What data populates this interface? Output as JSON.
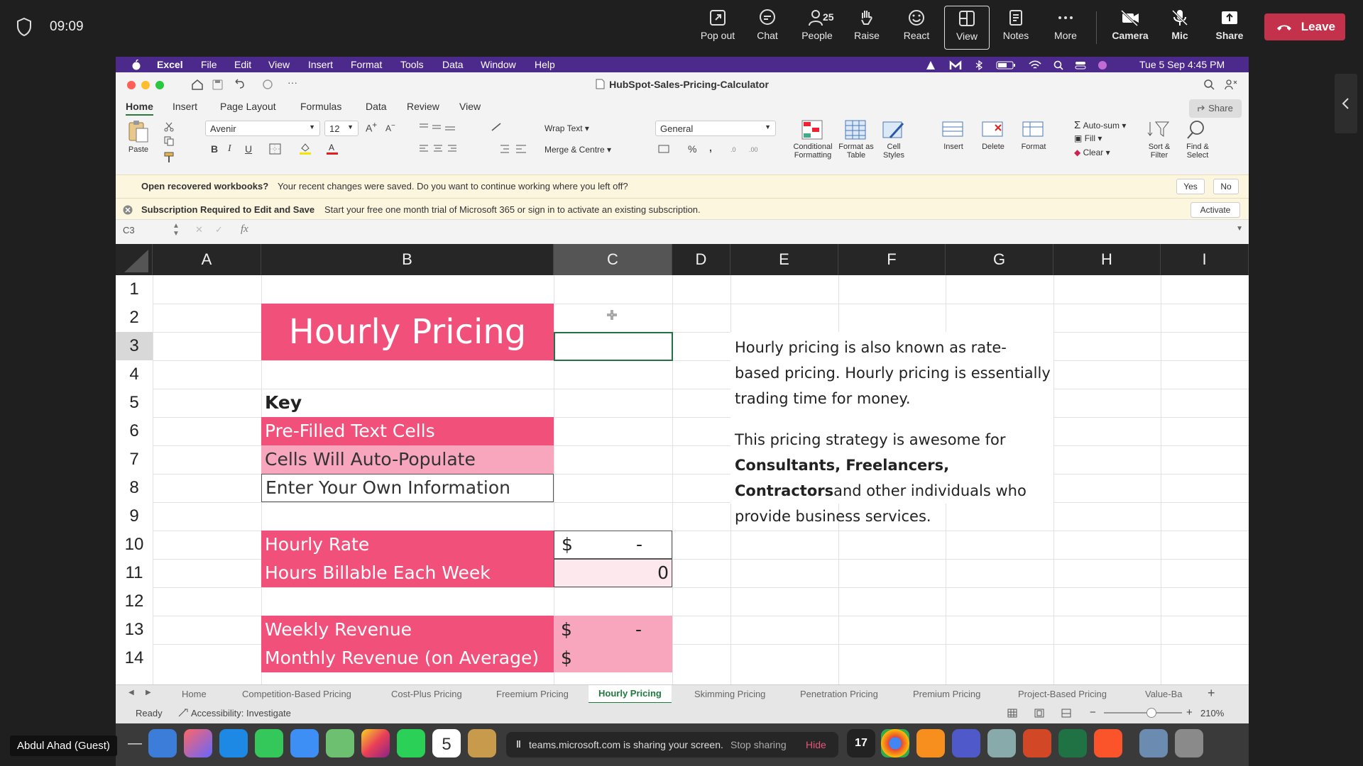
{
  "teams": {
    "time": "09:09",
    "buttons": [
      {
        "label": "Pop out",
        "icon": "pop-out-icon"
      },
      {
        "label": "Chat",
        "icon": "chat-icon"
      },
      {
        "label": "People",
        "icon": "people-icon",
        "count": "25"
      },
      {
        "label": "Raise",
        "icon": "raise-hand-icon"
      },
      {
        "label": "React",
        "icon": "react-icon"
      },
      {
        "label": "View",
        "icon": "view-icon"
      },
      {
        "label": "Notes",
        "icon": "notes-icon"
      },
      {
        "label": "More",
        "icon": "more-icon"
      },
      {
        "label": "Camera",
        "icon": "camera-off-icon"
      },
      {
        "label": "Mic",
        "icon": "mic-off-icon"
      },
      {
        "label": "Share",
        "icon": "share-icon"
      }
    ],
    "leave_label": "Leave",
    "leave_color": "#c4314b",
    "guest_name": "Abdul Ahad (Guest)"
  },
  "mac_menu": {
    "items": [
      "Excel",
      "File",
      "Edit",
      "View",
      "Insert",
      "Format",
      "Tools",
      "Data",
      "Window",
      "Help"
    ],
    "datetime": "Tue 5 Sep  4:45 PM"
  },
  "excel": {
    "title": "HubSpot-Sales-Pricing-Calculator",
    "tabs": [
      "Home",
      "Insert",
      "Page Layout",
      "Formulas",
      "Data",
      "Review",
      "View"
    ],
    "share_label": "Share",
    "ribbon": {
      "paste": "Paste",
      "font_name": "Avenir",
      "font_size": "12",
      "wrap_text": "Wrap Text",
      "merge_centre": "Merge & Centre",
      "number_format": "General",
      "conditional_formatting": "Conditional Formatting",
      "format_as_table": "Format as Table",
      "cell_styles": "Cell Styles",
      "insert": "Insert",
      "delete": "Delete",
      "format": "Format",
      "autosum": "Auto-sum",
      "fill": "Fill",
      "clear": "Clear",
      "sort_filter": "Sort & Filter",
      "find_select": "Find & Select",
      "bold": "B",
      "italic": "I",
      "underline": "U",
      "percent": "%"
    },
    "notice1": {
      "title": "Open recovered workbooks?",
      "text": "Your recent changes were saved. Do you want to continue working where you left off?",
      "yes": "Yes",
      "no": "No"
    },
    "notice2": {
      "title": "Subscription Required to Edit and Save",
      "text": "Start your free one month trial of Microsoft 365 or sign in to activate an existing subscription.",
      "button": "Activate"
    },
    "name_box": "C3",
    "fx": "fx",
    "columns": [
      "A",
      "B",
      "C",
      "D",
      "E",
      "F",
      "G",
      "H",
      "I"
    ],
    "rows": [
      "1",
      "2",
      "3",
      "4",
      "5",
      "6",
      "7",
      "8",
      "9",
      "10",
      "11",
      "12",
      "13",
      "14"
    ],
    "cells": {
      "title": "Hourly Pricing",
      "key": "Key",
      "prefilled": "Pre-Filled Text Cells",
      "autopopulate": "Cells Will Auto-Populate",
      "enter_own": "Enter Your Own Information",
      "hourly_rate": "Hourly Rate",
      "hourly_rate_currency": "$",
      "hourly_rate_value": "-",
      "hours_billable": "Hours Billable Each Week",
      "hours_billable_value": "0",
      "weekly_revenue": "Weekly Revenue",
      "weekly_revenue_currency": "$",
      "weekly_revenue_value": "-",
      "monthly_revenue": "Monthly Revenue (on Average)",
      "monthly_revenue_currency": "$"
    },
    "description": {
      "p1": "Hourly pricing is also known as rate-based pricing. Hourly pricing is essentially trading time for money.",
      "p2_start": "This pricing strategy is awesome for ",
      "p2_bold": "Consultants, Freelancers, Contractors",
      "p2_end": "and other individuals who provide business services."
    },
    "colors": {
      "pink_dark": "#f0507a",
      "pink_light": "#f7a6bd",
      "header_bg": "#262626"
    },
    "sheets": [
      "Home",
      "Competition-Based Pricing",
      "Cost-Plus Pricing",
      "Freemium Pricing",
      "Hourly Pricing",
      "Skimming Pricing",
      "Penetration Pricing",
      "Premium Pricing",
      "Project-Based Pricing",
      "Value-Ba"
    ],
    "active_sheet": "Hourly Pricing",
    "status": "Ready",
    "accessibility": "Accessibility: Investigate",
    "zoom": "210%"
  },
  "screen_share": {
    "text": "teams.microsoft.com is sharing your screen.",
    "stop": "Stop sharing",
    "hide": "Hide",
    "calendar_day": "5"
  }
}
